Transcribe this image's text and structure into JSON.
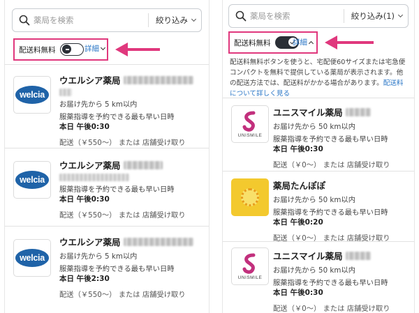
{
  "left": {
    "search_placeholder": "薬局を検索",
    "filter_label": "絞り込み",
    "free_label": "配送料無料",
    "detail_label": "詳細",
    "cards": [
      {
        "name": "ウエルシア薬局",
        "distance": "お届け先から 5 km以内",
        "earliest_label": "服薬指導を予約できる最も早い日時",
        "day": "本日 午後0:30",
        "shipping": "配送（￥550～） または 店舗受け取り",
        "logo_text": "welcia"
      },
      {
        "name": "ウエルシア薬局",
        "distance": "",
        "earliest_label": "服薬指導を予約できる最も早い日時",
        "day": "本日 午後0:30",
        "shipping": "配送（￥550～） または 店舗受け取り",
        "logo_text": "welcia"
      },
      {
        "name": "ウエルシア薬局",
        "distance": "お届け先から 5 km以内",
        "earliest_label": "服薬指導を予約できる最も早い日時",
        "day": "本日 午後2:30",
        "shipping": "配送（￥550～） または 店舗受け取り",
        "logo_text": "welcia"
      }
    ]
  },
  "right": {
    "search_placeholder": "薬局を検索",
    "filter_label": "絞り込み(1)",
    "free_label": "配送料無料",
    "detail_label": "詳細",
    "description": "配送料無料ボタンを使うと、宅配便60サイズまたは宅急便コンパクトを無料で提供している薬局が表示されます。他の配送方法では、配送料がかかる場合があります。",
    "description_link": "配送料について詳しく見る",
    "cards": [
      {
        "name": "ユニスマイル薬局",
        "distance": "お届け先から 50 km以内",
        "earliest_label": "服薬指導を予約できる最も早い日時",
        "day": "本日 午後0:30",
        "shipping": "配送（￥0～） または 店舗受け取り",
        "logo_text": "UNISMILE"
      },
      {
        "name": "薬局たんぽぽ",
        "distance": "お届け先から 50 km以内",
        "earliest_label": "服薬指導を予約できる最も早い日時",
        "day": "本日 午後0:20",
        "shipping": "配送（￥0～） または 店舗受け取り",
        "logo_text": ""
      },
      {
        "name": "ユニスマイル薬局",
        "distance": "お届け先から 50 km以内",
        "earliest_label": "服薬指導を予約できる最も早い日時",
        "day": "本日 午後0:30",
        "shipping": "配送（￥0～） または 店舗受け取り",
        "logo_text": "UNISMILE"
      }
    ]
  },
  "colors": {
    "highlight": "#e0387d",
    "link": "#2b77c7",
    "welcia_blue": "#1f63a8",
    "toggle_dark": "#2a2f36"
  },
  "icons": {
    "search": "search-icon",
    "toggle_off": "toggle-off-icon",
    "toggle_on": "toggle-on-check-icon",
    "chevron_down": "chevron-down-icon",
    "chevron_up": "chevron-up-icon",
    "arrow": "pointer-arrow-icon"
  }
}
